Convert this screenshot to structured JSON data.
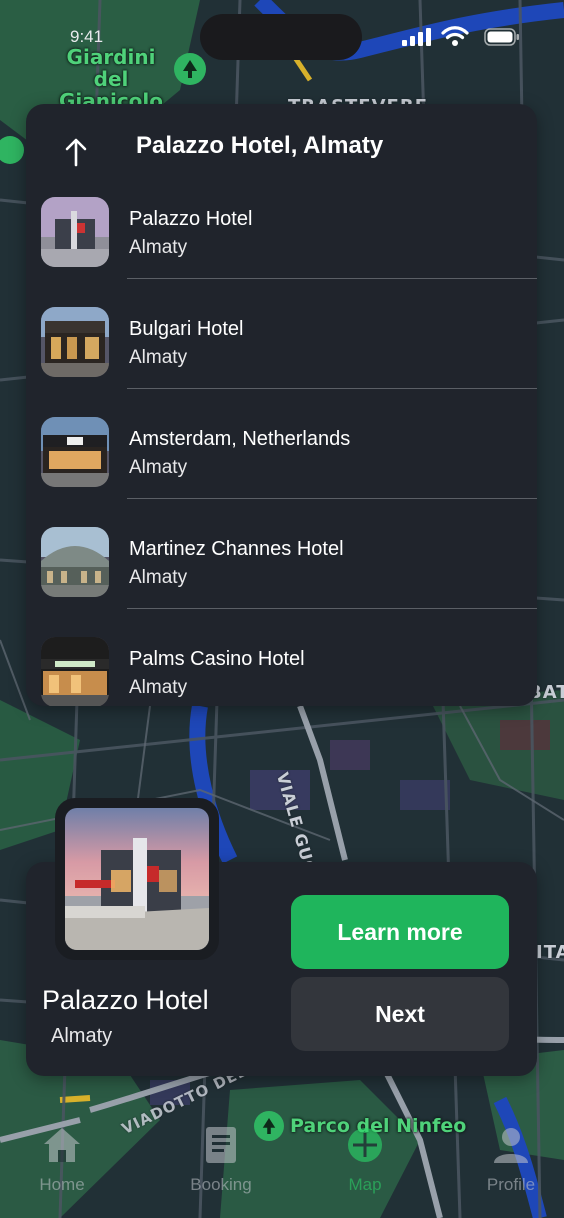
{
  "status_bar": {
    "time": "9:41"
  },
  "map": {
    "labels": {
      "giardini_line1": "Giardini del",
      "giardini_line2": "Gianicolo",
      "trastevere": "TRASTEVERE",
      "parco": "Parco del Ninfeo",
      "viale": "VIALE GUGLIELMO",
      "viadotto": "VIADOTTO DELLA MAGLIANA",
      "edge_bat": "BAT",
      "edge_ita": "ITA"
    }
  },
  "search": {
    "title": "Palazzo Hotel, Almaty",
    "results": [
      {
        "name": "Palazzo Hotel",
        "city": "Almaty",
        "thumb_color": "#b8a8c8"
      },
      {
        "name": "Bulgari Hotel",
        "city": "Almaty",
        "thumb_color": "#8aa6c8"
      },
      {
        "name": "Amsterdam, Netherlands",
        "city": "Almaty",
        "thumb_color": "#6e8fb5",
        "sign": "CAVA"
      },
      {
        "name": "Martinez Channes Hotel",
        "city": "Almaty",
        "thumb_color": "#9fb6c8"
      },
      {
        "name": "Palms Casino Hotel",
        "city": "Almaty",
        "thumb_color": "#3a3a3a",
        "sign": "SHAKE SHACK"
      }
    ]
  },
  "card": {
    "name": "Palazzo Hotel",
    "city": "Almaty",
    "learn_more_label": "Learn more",
    "next_label": "Next"
  },
  "tabs": [
    {
      "label": "Home",
      "icon": "home-icon"
    },
    {
      "label": "Booking",
      "icon": "booking-icon"
    },
    {
      "label": "Map",
      "icon": "map-icon",
      "active": true
    },
    {
      "label": "Profile",
      "icon": "profile-icon"
    }
  ],
  "colors": {
    "accent": "#1fb55c",
    "panel": "#20242c",
    "map_water": "#1e47b8",
    "map_park": "#2d6b4a"
  }
}
